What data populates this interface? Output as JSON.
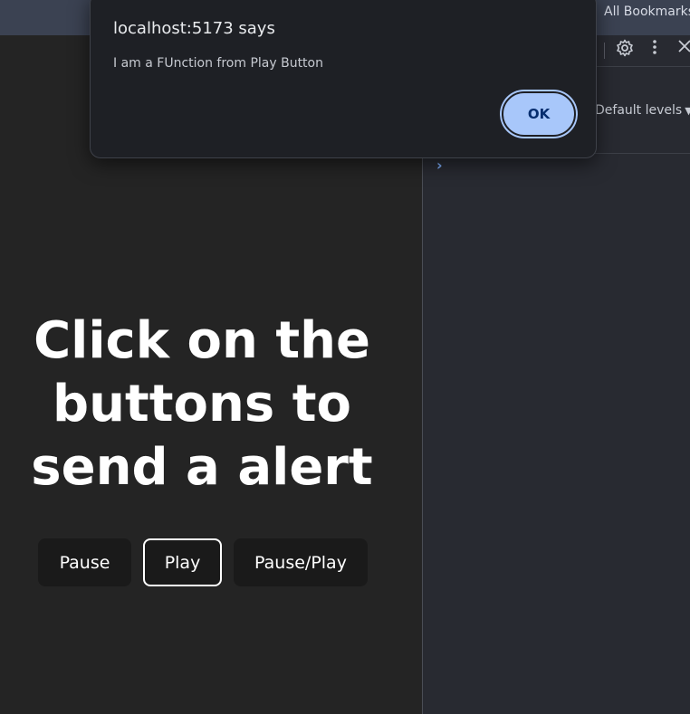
{
  "browser": {
    "bookmarks_label": "All Bookmarks"
  },
  "page": {
    "headline": "Click on the buttons to send a alert",
    "buttons": [
      {
        "label": "Pause"
      },
      {
        "label": "Play"
      },
      {
        "label": "Pause/Play"
      }
    ]
  },
  "devtools": {
    "icons": [
      "gear-icon",
      "kebab-menu-icon",
      "close-icon"
    ],
    "levels_label": "Default levels",
    "prompt_glyph": "›"
  },
  "alert": {
    "title": "localhost:5173 says",
    "message": "I am a FUnction from Play Button",
    "ok_label": "OK"
  },
  "colors": {
    "page_bg": "#242424",
    "button_bg": "#1a1a1a",
    "ok_button": "#a8c7fa",
    "dialog_bg": "#1e2025"
  }
}
